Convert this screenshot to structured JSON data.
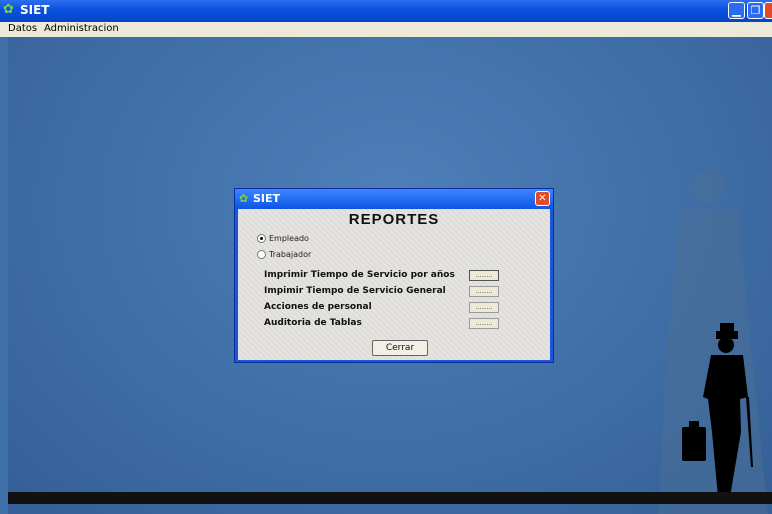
{
  "window": {
    "title": "SIET",
    "icon": "plant-icon",
    "controls": [
      "minimize-icon",
      "restore-icon",
      "close-icon"
    ]
  },
  "menu": {
    "items": [
      "Datos",
      "Administracion"
    ]
  },
  "dialog": {
    "title": "SIET",
    "heading": "REPORTES",
    "radios": [
      {
        "label": "Empleado",
        "checked": true
      },
      {
        "label": "Trabajador",
        "checked": false
      }
    ],
    "rows": [
      {
        "label": "Imprimir Tiempo de Servicio por años",
        "button": "........"
      },
      {
        "label": "Impimir Tiempo de Servicio General",
        "button": "........"
      },
      {
        "label": "Acciones de personal",
        "button": "........"
      },
      {
        "label": "Auditoria de Tablas",
        "button": "........"
      }
    ],
    "close_button": "Cerrar"
  },
  "colors": {
    "desktop": "#3f6fa8",
    "titlebar": "#0a53e0",
    "dialog_body": "#e5e3e0",
    "close_red": "#e2492d"
  }
}
